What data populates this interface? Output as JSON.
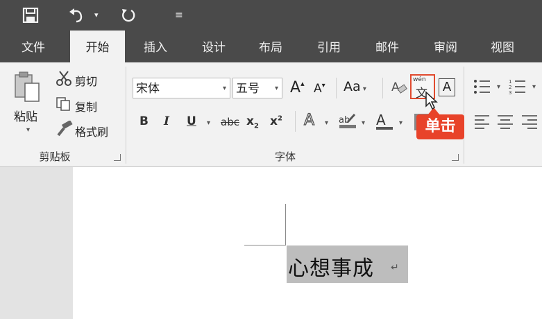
{
  "quick_access": {
    "save_icon": "save-icon",
    "undo_icon": "undo-icon",
    "redo_icon": "redo-icon",
    "customize_icon": "customize-icon"
  },
  "tabs": [
    {
      "label": "文件"
    },
    {
      "label": "开始"
    },
    {
      "label": "插入"
    },
    {
      "label": "设计"
    },
    {
      "label": "布局"
    },
    {
      "label": "引用"
    },
    {
      "label": "邮件"
    },
    {
      "label": "审阅"
    },
    {
      "label": "视图"
    }
  ],
  "clipboard": {
    "paste_label": "粘贴",
    "cut_label": "剪切",
    "copy_label": "复制",
    "format_painter_label": "格式刷",
    "group_label": "剪贴板"
  },
  "font": {
    "font_name": "宋体",
    "font_size": "五号",
    "grow_label": "A",
    "shrink_label": "A",
    "case_label": "Aa",
    "bold": "B",
    "italic": "I",
    "underline": "U",
    "strike": "abc",
    "subscript": "x",
    "superscript": "x",
    "sub_mark": "2",
    "sup_mark": "2",
    "phonetic_top": "wén",
    "phonetic_char": "文",
    "border_char": "A",
    "effects_char": "A",
    "font_color_char": "A",
    "group_label": "字体"
  },
  "callout": {
    "text": "单击"
  },
  "document": {
    "text": "心想事成"
  },
  "colors": {
    "title_bar": "#4a4a4a",
    "ribbon": "#f2f2f2",
    "callout": "#e8432a",
    "selection": "#bdbdbd"
  }
}
